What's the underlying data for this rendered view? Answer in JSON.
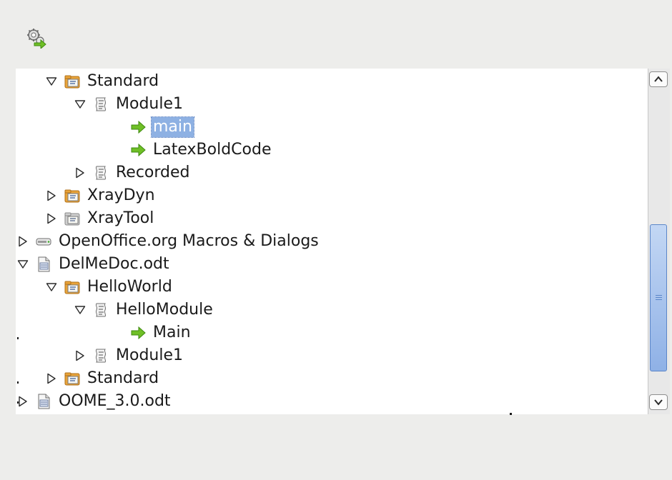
{
  "toolbar": {
    "icon": "macro-gear-icon"
  },
  "tree": {
    "rows": [
      {
        "label": "Standard",
        "icon": "library-folder-icon",
        "expanded": true
      },
      {
        "label": "Module1",
        "icon": "module-icon",
        "expanded": true
      },
      {
        "label": "main",
        "icon": "macro-arrow-icon",
        "selected": true
      },
      {
        "label": "LatexBoldCode",
        "icon": "macro-arrow-icon"
      },
      {
        "label": "Recorded",
        "icon": "module-icon",
        "expanded": false
      },
      {
        "label": "XrayDyn",
        "icon": "library-folder-icon",
        "expanded": false
      },
      {
        "label": "XrayTool",
        "icon": "library-folder-grey-icon",
        "expanded": false
      },
      {
        "label": "OpenOffice.org Macros & Dialogs",
        "icon": "drive-icon",
        "expanded": false
      },
      {
        "label": "DelMeDoc.odt",
        "icon": "document-icon",
        "expanded": true
      },
      {
        "label": "HelloWorld",
        "icon": "library-folder-icon",
        "expanded": true
      },
      {
        "label": "HelloModule",
        "icon": "module-icon",
        "expanded": true
      },
      {
        "label": "Main",
        "icon": "macro-arrow-icon"
      },
      {
        "label": "Module1",
        "icon": "module-icon",
        "expanded": false
      },
      {
        "label": "Standard",
        "icon": "library-folder-icon",
        "expanded": false
      },
      {
        "label": "OOME_3.0.odt",
        "icon": "document-icon",
        "expanded": false
      }
    ]
  },
  "scrollbar": {
    "position": 0.62
  }
}
